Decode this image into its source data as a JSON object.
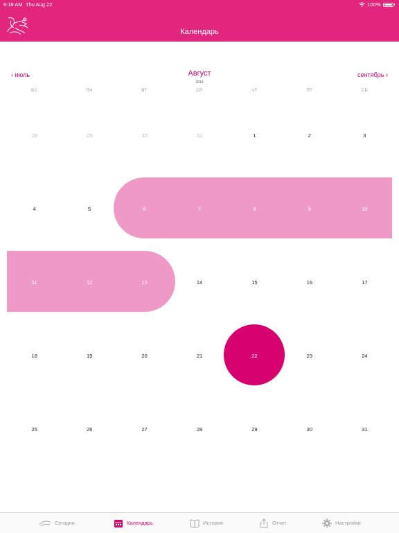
{
  "status": {
    "time": "9:18 AM",
    "date": "Thu Aug 22",
    "battery": "100%"
  },
  "header": {
    "title": "Календарь"
  },
  "nav": {
    "prev": "июль",
    "next": "сентябрь",
    "month": "Август",
    "year": "2019"
  },
  "weekdays": [
    "ВС",
    "ПН",
    "ВТ",
    "СР",
    "ЧТ",
    "ПТ",
    "СБ"
  ],
  "weeks": [
    [
      {
        "d": "28",
        "muted": true
      },
      {
        "d": "29",
        "muted": true
      },
      {
        "d": "30",
        "muted": true
      },
      {
        "d": "31",
        "muted": true
      },
      {
        "d": "1"
      },
      {
        "d": "2"
      },
      {
        "d": "3"
      }
    ],
    [
      {
        "d": "4"
      },
      {
        "d": "5"
      },
      {
        "d": "6",
        "period": true
      },
      {
        "d": "7",
        "period": true
      },
      {
        "d": "8",
        "period": true
      },
      {
        "d": "9",
        "period": true
      },
      {
        "d": "10",
        "period": true
      }
    ],
    [
      {
        "d": "11",
        "period": true
      },
      {
        "d": "12",
        "period": true
      },
      {
        "d": "13",
        "period": true
      },
      {
        "d": "14"
      },
      {
        "d": "15"
      },
      {
        "d": "16"
      },
      {
        "d": "17"
      }
    ],
    [
      {
        "d": "18"
      },
      {
        "d": "19"
      },
      {
        "d": "20"
      },
      {
        "d": "21"
      },
      {
        "d": "22",
        "today": true
      },
      {
        "d": "23"
      },
      {
        "d": "24"
      }
    ],
    [
      {
        "d": "25"
      },
      {
        "d": "26"
      },
      {
        "d": "27"
      },
      {
        "d": "28"
      },
      {
        "d": "29"
      },
      {
        "d": "30"
      },
      {
        "d": "31"
      }
    ]
  ],
  "tabs": [
    {
      "label": "Сегодня",
      "icon": "today-icon",
      "active": false
    },
    {
      "label": "Календарь",
      "icon": "calendar-icon",
      "active": true
    },
    {
      "label": "История",
      "icon": "book-icon",
      "active": false
    },
    {
      "label": "Отчет",
      "icon": "share-icon",
      "active": false
    },
    {
      "label": "Настройки",
      "icon": "gear-icon",
      "active": false
    }
  ],
  "colors": {
    "brand": "#e2267e",
    "accent": "#d6006e",
    "period": "#ef9ac6"
  }
}
